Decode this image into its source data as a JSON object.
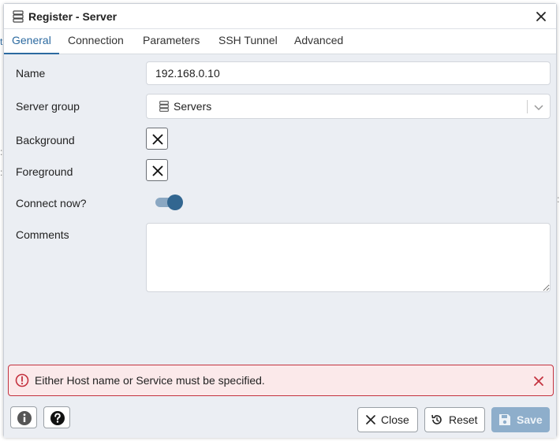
{
  "dialog": {
    "title": "Register - Server",
    "icon": "server-icon"
  },
  "tabs": [
    {
      "label": "General",
      "active": true
    },
    {
      "label": "Connection",
      "active": false
    },
    {
      "label": "Parameters",
      "active": false
    },
    {
      "label": "SSH Tunnel",
      "active": false
    },
    {
      "label": "Advanced",
      "active": false
    }
  ],
  "form": {
    "name": {
      "label": "Name",
      "value": "192.168.0.10"
    },
    "server_group": {
      "label": "Server group",
      "value": "Servers",
      "icon": "server-group-icon"
    },
    "background": {
      "label": "Background",
      "icon": "clear-x-icon"
    },
    "foreground": {
      "label": "Foreground",
      "icon": "clear-x-icon"
    },
    "connect_now": {
      "label": "Connect now?",
      "enabled": true
    },
    "comments": {
      "label": "Comments",
      "value": ""
    }
  },
  "error": {
    "message": "Either Host name or Service must be specified.",
    "color": "#c4323f"
  },
  "footer": {
    "close_label": "Close",
    "reset_label": "Reset",
    "save_label": "Save"
  },
  "colors": {
    "accent": "#2c6aa0",
    "toggle": "#326690",
    "save_disabled": "#8eaecb"
  }
}
